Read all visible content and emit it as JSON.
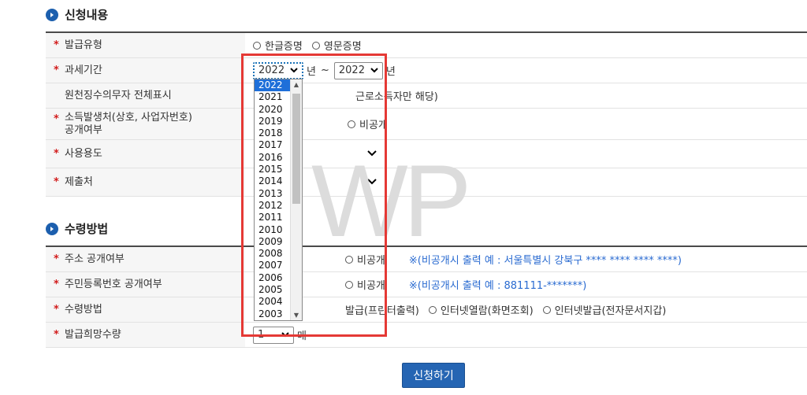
{
  "section1": {
    "title": "신청내용"
  },
  "section2": {
    "title": "수령방법"
  },
  "rows": {
    "issue_type": {
      "label": "발급유형",
      "opt1": "한글증명",
      "opt2": "영문증명"
    },
    "period": {
      "label": "과세기간",
      "from": "2022",
      "year_unit1": "년",
      "tilde": "~",
      "to": "2022",
      "year_unit2": "년"
    },
    "withholding": {
      "label": "원천징수의무자 전체표시",
      "note": "근로소득자만 해당)"
    },
    "income_source": {
      "label": "소득발생처(상호, 사업자번호)",
      "label2": "공개여부",
      "opt": "비공개"
    },
    "usage": {
      "label": "사용용도"
    },
    "submit_to": {
      "label": "제출처"
    },
    "address": {
      "label": "주소 공개여부",
      "opt": "비공개",
      "note": "※(비공개시 출력 예 : 서울특별시 강북구 **** **** **** ****)"
    },
    "resident_no": {
      "label": "주민등록번호 공개여부",
      "opt": "비공개",
      "note": "※(비공개시 출력 예 : 881111-*******)"
    },
    "receive": {
      "label": "수령방법",
      "opt1": "발급(프린터출력)",
      "opt2": "인터넷열람(화면조회)",
      "opt3": "인터넷발급(전자문서지갑)"
    },
    "quantity": {
      "label": "발급희망수량",
      "value": "1",
      "unit": "매"
    }
  },
  "dropdown": {
    "years": [
      "2022",
      "2021",
      "2020",
      "2019",
      "2018",
      "2017",
      "2016",
      "2015",
      "2014",
      "2013",
      "2012",
      "2011",
      "2010",
      "2009",
      "2008",
      "2007",
      "2006",
      "2005",
      "2004",
      "2003"
    ],
    "selected": "2022"
  },
  "watermark": "WP",
  "submit_label": "신청하기",
  "colors": {
    "accent": "#2565b3",
    "required": "#d21d1d",
    "highlight": "#e53935",
    "note": "#2a6bd1"
  }
}
